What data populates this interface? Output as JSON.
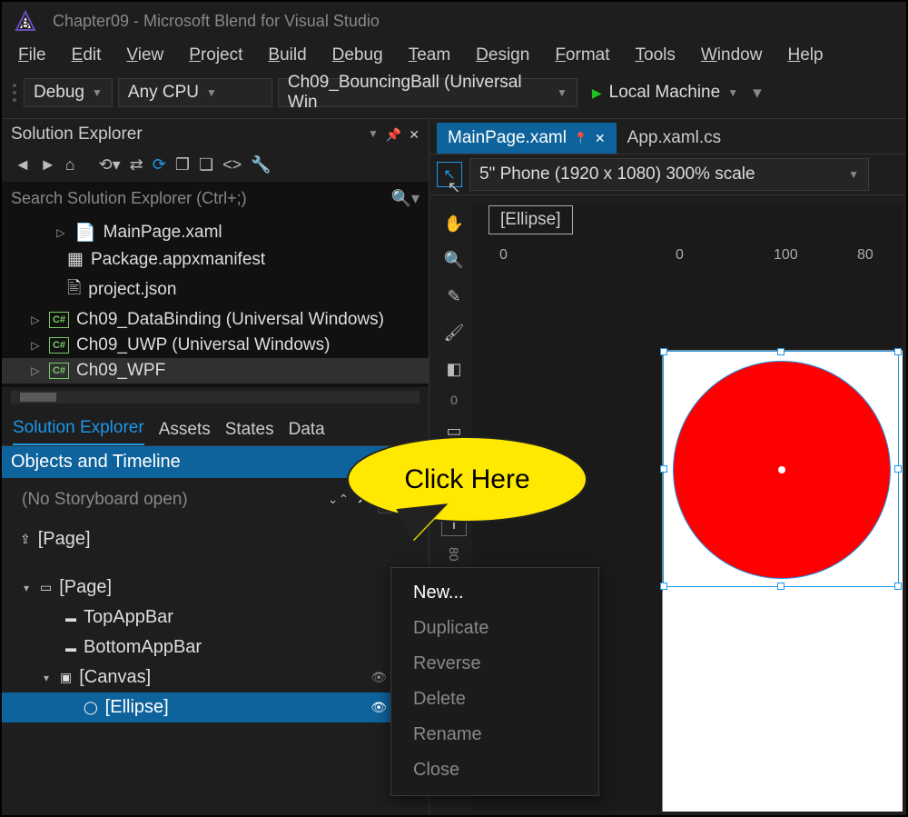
{
  "app": {
    "title": "Chapter09 - Microsoft Blend for Visual Studio"
  },
  "menu": {
    "file": "File",
    "edit": "Edit",
    "view": "View",
    "project": "Project",
    "build": "Build",
    "debug": "Debug",
    "team": "Team",
    "design": "Design",
    "format": "Format",
    "tools": "Tools",
    "window": "Window",
    "help": "Help"
  },
  "toolbar": {
    "config": "Debug",
    "platform": "Any CPU",
    "startup": "Ch09_BouncingBall (Universal Win",
    "run_target": "Local Machine"
  },
  "solution_explorer": {
    "title": "Solution Explorer",
    "search_placeholder": "Search Solution Explorer (Ctrl+;)",
    "items": {
      "mainpage": "MainPage.xaml",
      "manifest": "Package.appxmanifest",
      "projectjson": "project.json",
      "databinding": "Ch09_DataBinding (Universal Windows)",
      "uwp": "Ch09_UWP (Universal Windows)",
      "wpf": "Ch09_WPF"
    }
  },
  "bottom_tabs": {
    "solution_explorer": "Solution Explorer",
    "assets": "Assets",
    "states": "States",
    "data": "Data"
  },
  "objects_panel": {
    "title": "Objects and Timeline",
    "no_storyboard": "(No Storyboard open)",
    "root_page": "[Page]",
    "page": "[Page]",
    "topappbar": "TopAppBar",
    "bottomappbar": "BottomAppBar",
    "canvas": "[Canvas]",
    "ellipse": "[Ellipse]"
  },
  "document_tabs": {
    "active": "MainPage.xaml",
    "inactive": "App.xaml.cs"
  },
  "designer": {
    "device_label": "5\" Phone (1920 x 1080) 300% scale",
    "selection_label": "[Ellipse]",
    "ruler_ticks": {
      "a": "0",
      "b": "0",
      "c": "100",
      "d": "80"
    }
  },
  "context_menu": {
    "new": "New...",
    "duplicate": "Duplicate",
    "reverse": "Reverse",
    "delete": "Delete",
    "rename": "Rename",
    "close": "Close"
  },
  "callout": {
    "text": "Click Here"
  },
  "side_ruler_values": {
    "a": "0",
    "b": "80"
  }
}
